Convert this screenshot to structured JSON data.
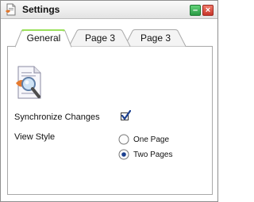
{
  "window": {
    "title": "Settings",
    "controls": [
      "minimize",
      "close"
    ]
  },
  "tabs": [
    {
      "label": "General",
      "active": true
    },
    {
      "label": "Page 3",
      "active": false
    },
    {
      "label": "Page 3",
      "active": false
    }
  ],
  "general": {
    "icon": "document-magnifier-icon",
    "sync_label": "Synchronize Changes",
    "sync_checked": true,
    "view_style_label": "View Style",
    "view_options": [
      {
        "label": "One Page",
        "selected": false
      },
      {
        "label": "Two Pages",
        "selected": true
      }
    ]
  },
  "colors": {
    "active_tab_accent": "#9be05c",
    "checkmark": "#1a3f8f",
    "minimize_button": "#3cb85a",
    "close_button": "#d9443a"
  }
}
